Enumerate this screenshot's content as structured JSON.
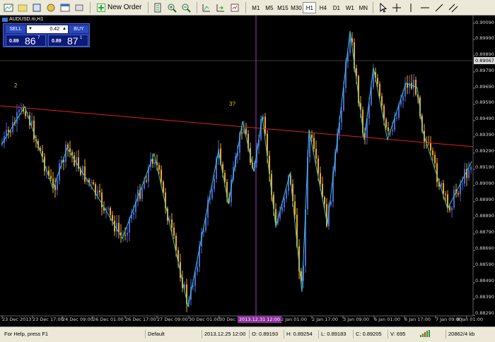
{
  "toolbar": {
    "new_order_label": "New Order",
    "timeframes": [
      "M1",
      "M5",
      "M15",
      "M30",
      "H1",
      "H4",
      "D1",
      "W1",
      "MN"
    ],
    "active_timeframe": "H1"
  },
  "chart": {
    "symbol_title": "AUDUSD.m,H1",
    "wave_label_1": "2",
    "wave_label_2": "3?",
    "current_price": "0.89067",
    "cursor_time": "2013.12.31 12:00",
    "price_labels": [
      "0.90090",
      "0.89990",
      "0.89890",
      "0.89790",
      "0.89690",
      "0.89590",
      "0.89490",
      "0.89390",
      "0.89290",
      "0.89190",
      "0.89090",
      "0.88990",
      "0.88890",
      "0.88790",
      "0.88690",
      "0.88590",
      "0.88490",
      "0.88390",
      "0.88290"
    ],
    "time_labels": [
      "23 Dec 2013",
      "23 Dec 17:00",
      "24 Dec 09:00",
      "26 Dec 01:00",
      "26 Dec 17:00",
      "27 Dec 09:00",
      "30 Dec 01:00",
      "30 Dec 17:00",
      "2 Jan 01:00",
      "2 Jan 17:00",
      "3 Jan 09:00",
      "6 Jan 01:00",
      "6 Jan 17:00",
      "7 Jan 09:00",
      "8 Jan 01:00"
    ]
  },
  "trade_panel": {
    "sell_label": "SELL",
    "buy_label": "BUY",
    "lot_value": "0.42",
    "sell_price_small": "0.89",
    "sell_price_big": "86",
    "sell_price_sup": "7",
    "buy_price_small": "0.89",
    "buy_price_big": "87",
    "buy_price_sup": "1"
  },
  "tabs": {
    "active_tab": "AUDUSD.m,H1"
  },
  "statusbar": {
    "help": "For Help, press F1",
    "profile": "Default",
    "datetime": "2013.12.25 12:00",
    "open": "O: 0.89193",
    "high": "H: 0.89254",
    "low": "L: 0.89183",
    "close": "C: 0.89205",
    "volume": "V: 695",
    "traffic": "20862/4 kb"
  },
  "colors": {
    "bull_candle": "#4f63d9",
    "bear_candle": "#f5a623",
    "zigzag": "#33cccc",
    "trendline": "#e02020",
    "cursor_line": "#a040c0"
  }
}
